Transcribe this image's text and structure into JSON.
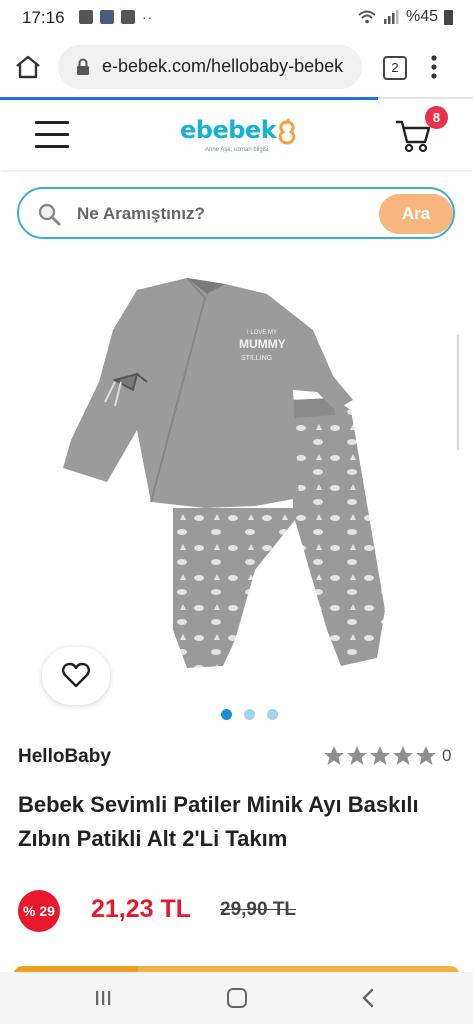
{
  "status_bar": {
    "time": "17:16",
    "battery_text": "%45",
    "overflow_dots": "··"
  },
  "browser": {
    "url": "e-bebek.com/hellobaby-bebek",
    "tab_count": "2"
  },
  "header": {
    "logo_text": "ebebek",
    "logo_tagline": "Anne Aşk, uzman bilgisi",
    "cart_count": "8"
  },
  "search": {
    "placeholder": "Ne Aramıştınız?",
    "button_label": "Ara"
  },
  "gallery": {
    "image_count": 3,
    "active_index": 0,
    "print_text": "I LOVE MY MUMMY STILLING"
  },
  "product": {
    "brand": "HelloBaby",
    "rating": 0,
    "rating_count": "0",
    "title": "Bebek Sevimli Patiler Minik Ayı Baskılı Zıbın Patikli Alt 2'Li Takım",
    "discount_badge": "% 29",
    "price": "21,23 TL",
    "old_price": "29,90 TL"
  },
  "colors": {
    "brand_blue": "#17b3d0",
    "accent_orange": "#f6b67d",
    "sale_red": "#e8182d",
    "badge_red": "#e8314d"
  }
}
